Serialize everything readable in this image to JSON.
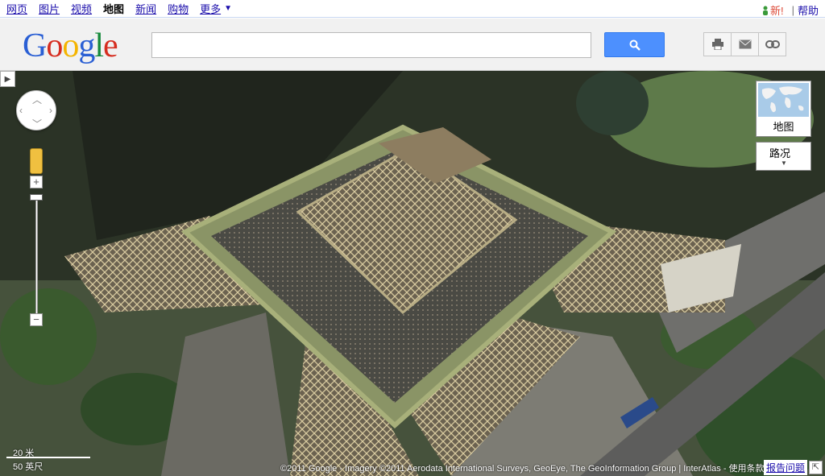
{
  "nav": {
    "items": [
      {
        "label": "网页",
        "active": false
      },
      {
        "label": "图片",
        "active": false
      },
      {
        "label": "视频",
        "active": false
      },
      {
        "label": "地图",
        "active": true
      },
      {
        "label": "新闻",
        "active": false
      },
      {
        "label": "购物",
        "active": false
      },
      {
        "label": "更多",
        "active": false
      }
    ],
    "more_arrow": "▼",
    "new_label": "新!",
    "separator": "|",
    "help_label": "帮助"
  },
  "header": {
    "logo": {
      "G": "G",
      "o1": "o",
      "o2": "o",
      "g": "g",
      "l": "l",
      "e": "e"
    },
    "search_value": "",
    "search_placeholder": "",
    "tools": [
      "printer-icon",
      "email-icon",
      "link-icon"
    ]
  },
  "map": {
    "panel_toggle": "▶",
    "map_type_label": "地图",
    "traffic_label": "路况",
    "traffic_caret": "▼",
    "scale_metric": "20 米",
    "scale_imperial": "50 英尺",
    "copyright": "©2011 Google - Imagery ©2011 Aerodata International Surveys, GeoEye, The GeoInformation Group | InterAtlas - 使用条款",
    "report_label": "报告问题",
    "zoom_in": "+",
    "zoom_out": "−",
    "zoom_level_fraction": 0.0,
    "colors": {
      "accent": "#4d90fe",
      "tower": "#c9b98f",
      "trees": "#2f4a28"
    }
  }
}
